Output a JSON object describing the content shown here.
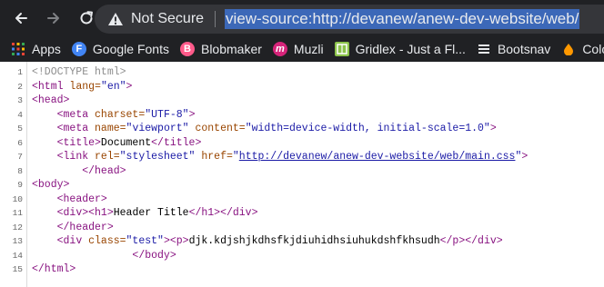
{
  "toolbar": {
    "security_label": "Not Secure",
    "url": "view-source:http://devanew/anew-dev-website/web/"
  },
  "bookmarks": [
    {
      "label": "Apps",
      "icon": "apps-grid-icon",
      "color": "#e8eaed"
    },
    {
      "label": "Google Fonts",
      "icon": "google-fonts-icon",
      "color": "#4285f4"
    },
    {
      "label": "Blobmaker",
      "icon": "blobmaker-icon",
      "color": "#ff5a8a"
    },
    {
      "label": "Muzli",
      "icon": "muzli-icon",
      "color": "#d6247a"
    },
    {
      "label": "Gridlex - Just a Fl...",
      "icon": "gridlex-icon",
      "color": "#8bc34a"
    },
    {
      "label": "Bootsnav",
      "icon": "bootsnav-icon",
      "color": "#e8eaed"
    },
    {
      "label": "Colo",
      "icon": "colors-icon",
      "color": "#ff9800"
    }
  ],
  "source": {
    "line_numbers": [
      "1",
      "2",
      "3",
      "4",
      "5",
      "6",
      "7",
      "8",
      "9",
      "10",
      "11",
      "12",
      "13",
      "14",
      "15"
    ],
    "doctype": "<!DOCTYPE html>",
    "html_open": "<html",
    "lang_attr": " lang=",
    "lang_val": "\"en\"",
    "close_bracket": ">",
    "head_open": "<head>",
    "meta_open": "<meta",
    "charset_attr": " charset=",
    "charset_val": "\"UTF-8\"",
    "name_attr": " name=",
    "name_val": "\"viewport\"",
    "content_attr": " content=",
    "content_val": "\"width=device-width, initial-scale=1.0\"",
    "title_open": "<title>",
    "title_text": "Document",
    "title_close": "</title>",
    "link_open": "<link",
    "rel_attr": " rel=",
    "rel_val": "\"stylesheet\"",
    "href_attr": " href=",
    "quote": "\"",
    "href_val": "http://devanew/anew-dev-website/web/main.css",
    "head_close": "</head>",
    "body_open": "<body>",
    "header_open": "<header>",
    "div_open": "<div>",
    "h1_open": "<h1>",
    "h1_text": "Header Title",
    "h1_close": "</h1>",
    "div_close": "</div>",
    "header_close": "</header>",
    "div_class_open": "<div",
    "class_attr": " class=",
    "class_val": "\"test\"",
    "p_open": "<p>",
    "p_text": "djk.kdjshjkdhsfkjdiuhidhsiuhukdshfkhsudh",
    "p_close": "</p>",
    "body_close": "</body>",
    "html_close": "</html>"
  },
  "colors": {
    "chrome_dark": "#202124",
    "omnibox": "#35363a",
    "url_highlight": "#3c68b8",
    "tag": "#881280",
    "attribute": "#994500",
    "value": "#1a1aa6"
  }
}
